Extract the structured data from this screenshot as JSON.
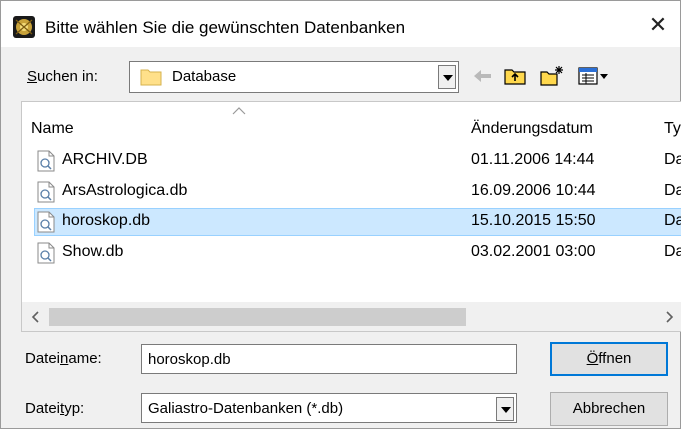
{
  "window": {
    "title": "Bitte wählen Sie die gewünschten Datenbanken",
    "close_glyph": "✕"
  },
  "lookin": {
    "label": "Suchen in:",
    "value": "Database"
  },
  "toolbar": {
    "icons": [
      "back-arrow-icon",
      "up-folder-icon",
      "new-folder-icon",
      "view-menu-icon"
    ]
  },
  "filelist": {
    "columns": [
      "Name",
      "Änderungsdatum",
      "Ty"
    ],
    "rows": [
      {
        "name": "ARCHIV.DB",
        "date": "01.11.2006 14:44",
        "type": "Da"
      },
      {
        "name": "ArsAstrologica.db",
        "date": "16.09.2006 10:44",
        "type": "Da"
      },
      {
        "name": "horoskop.db",
        "date": "15.10.2015 15:50",
        "type": "Da",
        "selected": true
      },
      {
        "name": "Show.db",
        "date": "03.02.2001 03:00",
        "type": "Da"
      }
    ]
  },
  "filename": {
    "label": "Dateiname:",
    "value": "horoskop.db"
  },
  "filetype": {
    "label": "Dateityp:",
    "value": "Galiastro-Datenbanken (*.db)"
  },
  "buttons": {
    "open": "Öffnen",
    "cancel": "Abbrechen"
  },
  "colors": {
    "selection_bg": "#cce8ff",
    "selection_border": "#99d1ff",
    "accent": "#0078d7"
  }
}
